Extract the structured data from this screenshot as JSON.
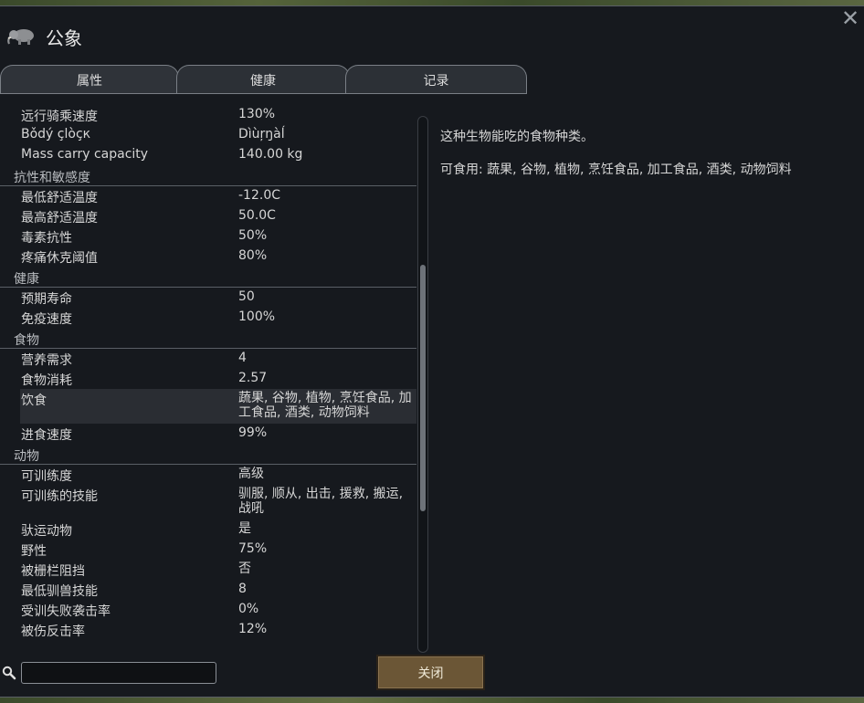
{
  "window": {
    "title": "公象",
    "close_symbol": "✕"
  },
  "tabs": [
    {
      "label": "属性"
    },
    {
      "label": "健康"
    },
    {
      "label": "记录"
    }
  ],
  "stats": {
    "top_rows": [
      {
        "k": "远行骑乘速度",
        "v": "130%"
      },
      {
        "k": "Bǒdý çlòçк",
        "v": "Dìùŗŋàĺ"
      },
      {
        "k": "Mass carry capacity",
        "v": "140.00 kg"
      }
    ],
    "sections": [
      {
        "title": "抗性和敏感度",
        "rows": [
          {
            "k": "最低舒适温度",
            "v": "-12.0C"
          },
          {
            "k": "最高舒适温度",
            "v": "50.0C"
          },
          {
            "k": "毒素抗性",
            "v": "50%"
          },
          {
            "k": "疼痛休克阈值",
            "v": "80%"
          }
        ]
      },
      {
        "title": "健康",
        "rows": [
          {
            "k": "预期寿命",
            "v": "50"
          },
          {
            "k": "免疫速度",
            "v": "100%"
          }
        ]
      },
      {
        "title": "食物",
        "rows": [
          {
            "k": "营养需求",
            "v": "4"
          },
          {
            "k": "食物消耗",
            "v": "2.57"
          },
          {
            "k": "饮食",
            "v": "蔬果, 谷物, 植物, 烹饪食品, 加工食品, 酒类, 动物饲料"
          },
          {
            "k": "进食速度",
            "v": "99%"
          }
        ]
      },
      {
        "title": "动物",
        "rows": [
          {
            "k": "可训练度",
            "v": "高级"
          },
          {
            "k": "可训练的技能",
            "v": "驯服, 顺从, 出击, 援救, 搬运, 战吼"
          },
          {
            "k": "驮运动物",
            "v": "是"
          },
          {
            "k": "野性",
            "v": "75%"
          },
          {
            "k": "被栅栏阻挡",
            "v": "否"
          },
          {
            "k": "最低驯兽技能",
            "v": "8"
          },
          {
            "k": "受训失败袭击率",
            "v": "0%"
          },
          {
            "k": "被伤反击率",
            "v": "12%"
          }
        ]
      }
    ]
  },
  "description": {
    "line1": "这种生物能吃的食物种类。",
    "line2": "可食用: 蔬果, 谷物, 植物, 烹饪食品, 加工食品, 酒类, 动物饲料"
  },
  "search": {
    "value": ""
  },
  "close_button": {
    "label": "关闭"
  },
  "colors": {
    "window_bg": "#16191e",
    "button_bg": "#6b5636",
    "text": "#d6d6d6"
  }
}
